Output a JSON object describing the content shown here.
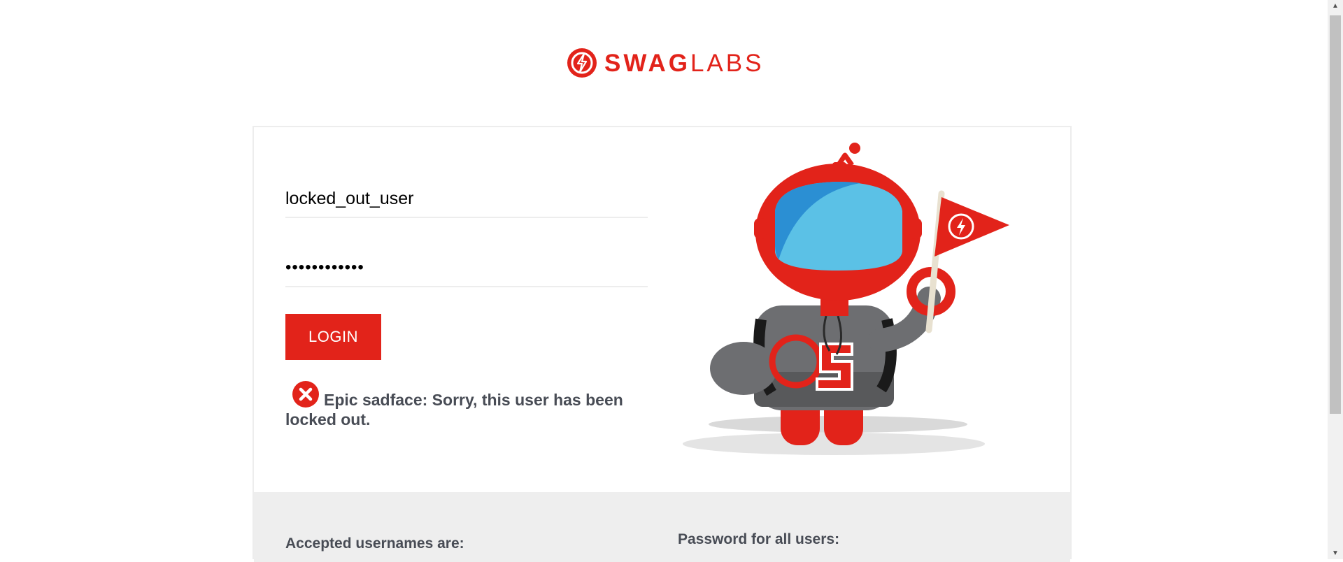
{
  "brand": {
    "name_bold": "SWAG",
    "name_light": "LABS",
    "accent_color": "#e2231a"
  },
  "login_form": {
    "username_value": "locked_out_user",
    "password_value": "••••••••••••",
    "login_label": "LOGIN"
  },
  "error": {
    "icon": "error-circle-x-icon",
    "message": "Epic sadface: Sorry, this user has been locked out."
  },
  "credentials_info": {
    "usernames_heading": "Accepted usernames are:",
    "password_heading": "Password for all users:"
  },
  "mascot": {
    "icon": "swag-bot-mascot"
  }
}
